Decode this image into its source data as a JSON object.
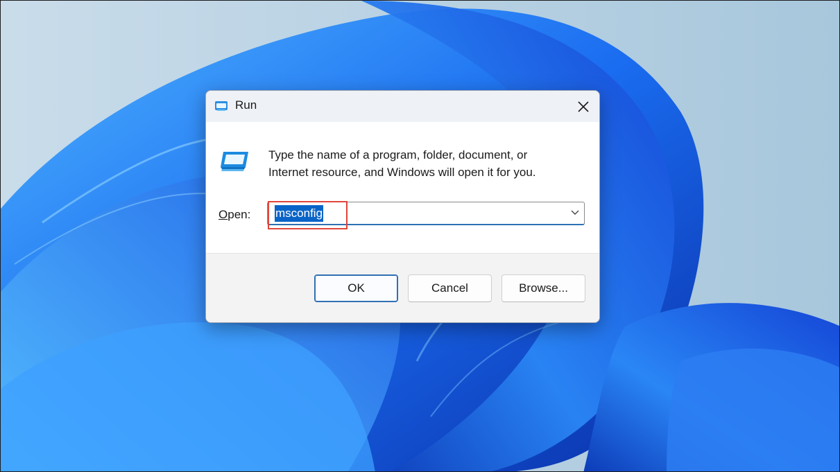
{
  "dialog": {
    "title": "Run",
    "description_line1": "Type the name of a program, folder, document, or",
    "description_line2": "Internet resource, and Windows will open it for you.",
    "open_label_accel": "O",
    "open_label_rest": "pen:",
    "open_value": "msconfig"
  },
  "buttons": {
    "ok": "OK",
    "cancel": "Cancel",
    "browse": "Browse..."
  },
  "icons": {
    "title": "run-icon",
    "big": "run-icon",
    "close": "close-icon",
    "dropdown": "chevron-down-icon"
  },
  "colors": {
    "selection": "#0a64c8",
    "highlight_annotation": "#e0443a",
    "accent": "#2f6fb3"
  }
}
